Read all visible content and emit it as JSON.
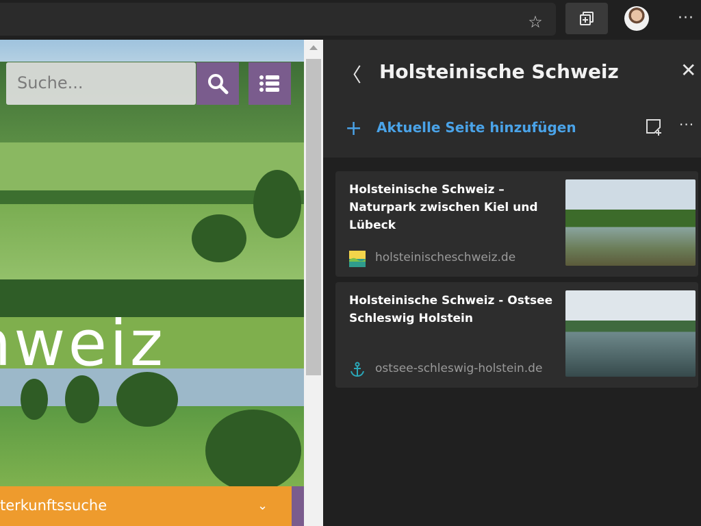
{
  "browser": {
    "favorite_icon": "star-icon",
    "collections_icon": "collections-icon",
    "more_icon": "more-icon"
  },
  "website": {
    "search_placeholder": "Suche...",
    "hero_word": "hweiz",
    "booking_label": "terkunftssuche",
    "accent_color": "#7a5c8d",
    "booking_color": "#ee9b2d"
  },
  "collection": {
    "title": "Holsteinische Schweiz",
    "add_current_label": "Aktuelle Seite hinzufügen",
    "items": [
      {
        "title": "Holsteinische Schweiz – Naturpark zwischen Kiel und Lübeck",
        "domain": "holsteinischeschweiz.de"
      },
      {
        "title": "Holsteinische Schweiz - Ostsee Schleswig Holstein",
        "domain": "ostsee-schleswig-holstein.de"
      }
    ],
    "link_color": "#4aa3e8"
  }
}
